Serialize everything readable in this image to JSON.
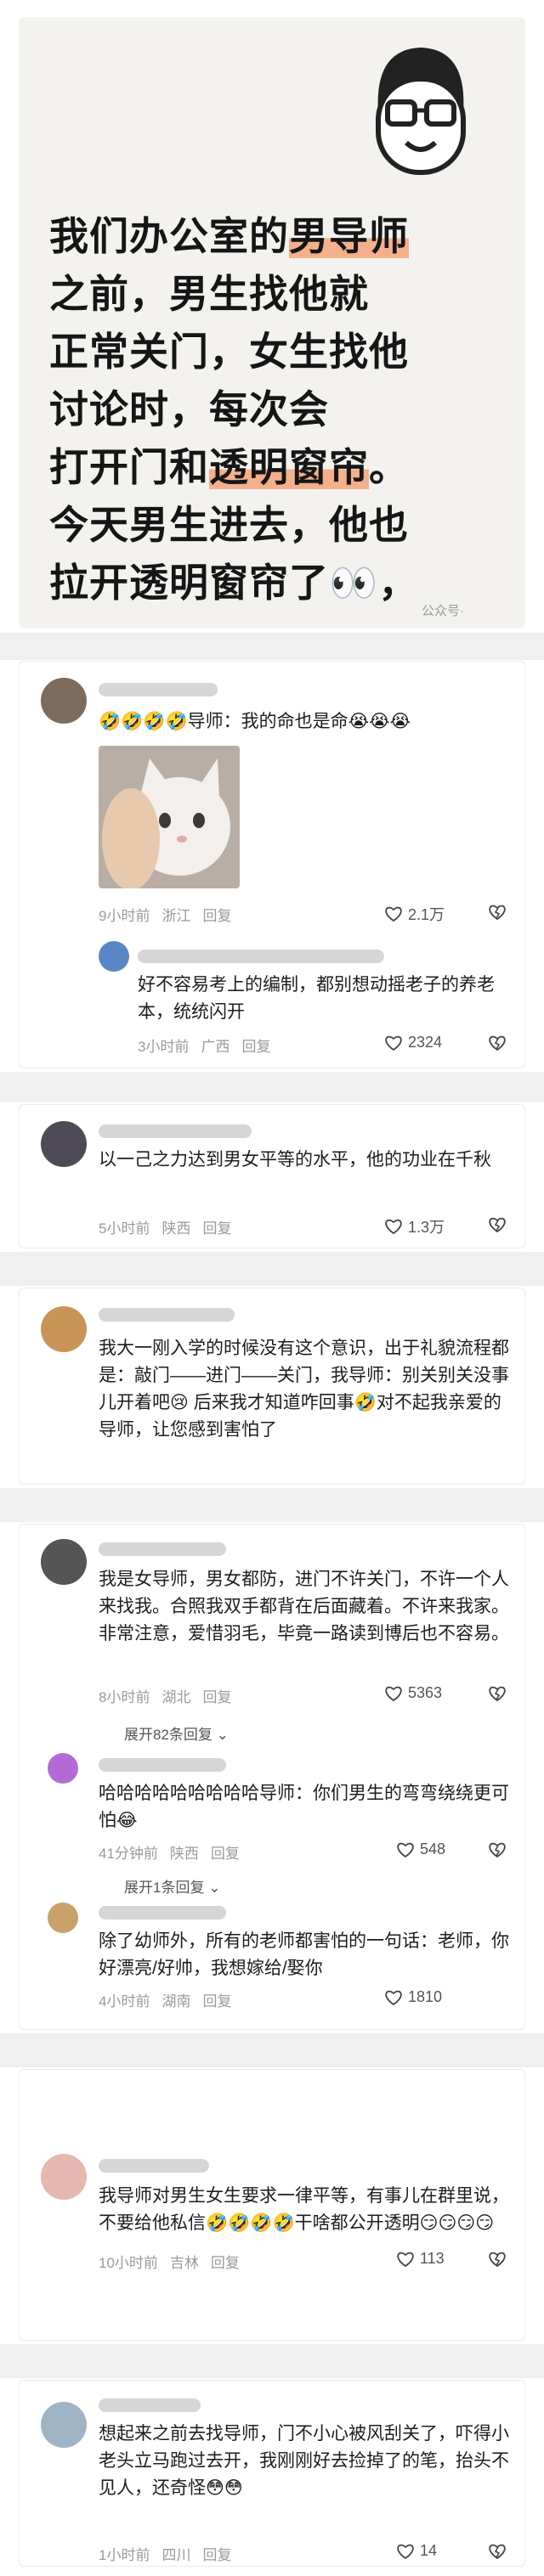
{
  "hero": {
    "lines": [
      {
        "pre": "我们办公室的",
        "hl": "男导师",
        "post": ""
      },
      {
        "pre": "之前，男生找他就",
        "hl": "",
        "post": ""
      },
      {
        "pre": "正常关门，女生找他",
        "hl": "",
        "post": ""
      },
      {
        "pre": "讨论时，每次会",
        "hl": "",
        "post": ""
      },
      {
        "pre": "打开门和",
        "hl": "透明窗帘",
        "post": "。"
      },
      {
        "pre": "今天男生进去，他也",
        "hl": "",
        "post": ""
      },
      {
        "pre": "拉开透明窗帘了👀，",
        "hl": "",
        "post": ""
      }
    ],
    "watermark": "公众号·"
  },
  "comments": [
    {
      "text": "🤣🤣🤣🤣导师：我的命也是命😭😭😭",
      "time": "9小时前",
      "loc": "浙江",
      "reply": "回复",
      "likes": "2.1万",
      "sub": {
        "text": "好不容易考上的编制，都别想动摇老子的养老本，统统闪开",
        "time": "3小时前",
        "loc": "广西",
        "reply": "回复",
        "likes": "2324"
      }
    },
    {
      "text": "以一己之力达到男女平等的水平，他的功业在千秋",
      "time": "5小时前",
      "loc": "陕西",
      "reply": "回复",
      "likes": "1.3万"
    },
    {
      "text": "我大一刚入学的时候没有这个意识，出于礼貌流程都是：敲门——进门——关门，我导师：别关别关没事儿开着吧😢 后来我才知道咋回事🤣对不起我亲爱的导师，让您感到害怕了"
    },
    {
      "text": "我是女导师，男女都防，进门不许关门，不许一个人来找我。合照我双手都背在后面藏着。不许来我家。非常注意，爱惜羽毛，毕竟一路读到博后也不容易。",
      "time": "8小时前",
      "loc": "湖北",
      "reply": "回复",
      "likes": "5363",
      "expand": "展开82条回复",
      "sub": {
        "text": "哈哈哈哈哈哈哈哈哈导师：你们男生的弯弯绕绕更可怕😂",
        "time": "41分钟前",
        "loc": "陕西",
        "reply": "回复",
        "likes": "548"
      },
      "expand2": "展开1条回复",
      "sub2": {
        "text": "除了幼师外，所有的老师都害怕的一句话：老师，你好漂亮/好帅，我想嫁给/娶你",
        "time": "4小时前",
        "loc": "湖南",
        "reply": "回复",
        "likes": "1810"
      }
    },
    {
      "text": "我导师对男生女生要求一律平等，有事儿在群里说，不要给他私信🤣🤣🤣🤣干啥都公开透明😏😏😏😏",
      "time": "10小时前",
      "loc": "吉林",
      "reply": "回复",
      "likes": "113"
    },
    {
      "text": "想起来之前去找导师，门不小心被风刮关了，吓得小老头立马跑过去开，我刚刚好去捡掉了的笔，抬头不见人，还奇怪😳😳",
      "time": "1小时前",
      "loc": "四川",
      "reply": "回复",
      "likes": "14"
    }
  ]
}
